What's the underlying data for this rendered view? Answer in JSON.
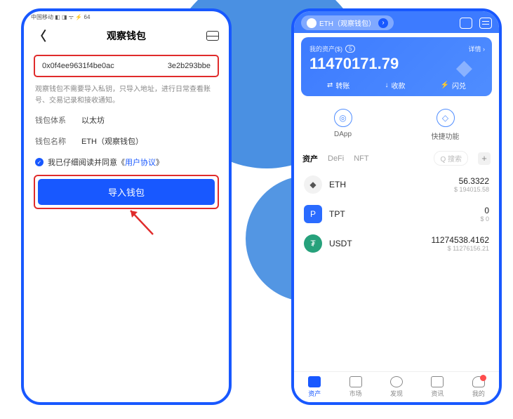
{
  "left": {
    "status": "中国移动 ◧ ◨ ᯤ ⚡ 64",
    "title": "观察钱包",
    "address_start": "0x0f4ee9631f4be0ac",
    "address_end": "3e2b293bbe",
    "desc": "观察钱包不需要导入私钥，只导入地址，进行日常查看账号、交易记录和接收通知。",
    "system_label": "钱包体系",
    "system_value": "以太坊",
    "name_label": "钱包名称",
    "name_value": "ETH（观察钱包）",
    "agree_prefix": "我已仔细阅读并同意《",
    "agree_link": "用户协议",
    "agree_suffix": "》",
    "import_btn": "导入钱包"
  },
  "right": {
    "wallet_chip": "ETH（观察钱包）",
    "asset_title": "我的资产($)",
    "asset_count": "5",
    "detail_label": "详情",
    "amount": "11470171.79",
    "actions": {
      "transfer": "转账",
      "receive": "收款",
      "swap": "闪兑"
    },
    "shortcuts": {
      "dapp": "DApp",
      "quick": "快捷功能"
    },
    "tabs": {
      "asset": "资产",
      "defi": "DeFi",
      "nft": "NFT",
      "search": "搜索"
    },
    "assets": [
      {
        "sym": "ETH",
        "amt": "56.3322",
        "fiat": "$ 194015.58"
      },
      {
        "sym": "TPT",
        "amt": "0",
        "fiat": "$ 0"
      },
      {
        "sym": "USDT",
        "amt": "11274538.4162",
        "fiat": "$ 11276156.21"
      }
    ],
    "tabbar": {
      "asset": "资产",
      "market": "市场",
      "discover": "发现",
      "news": "资讯",
      "me": "我的"
    }
  }
}
